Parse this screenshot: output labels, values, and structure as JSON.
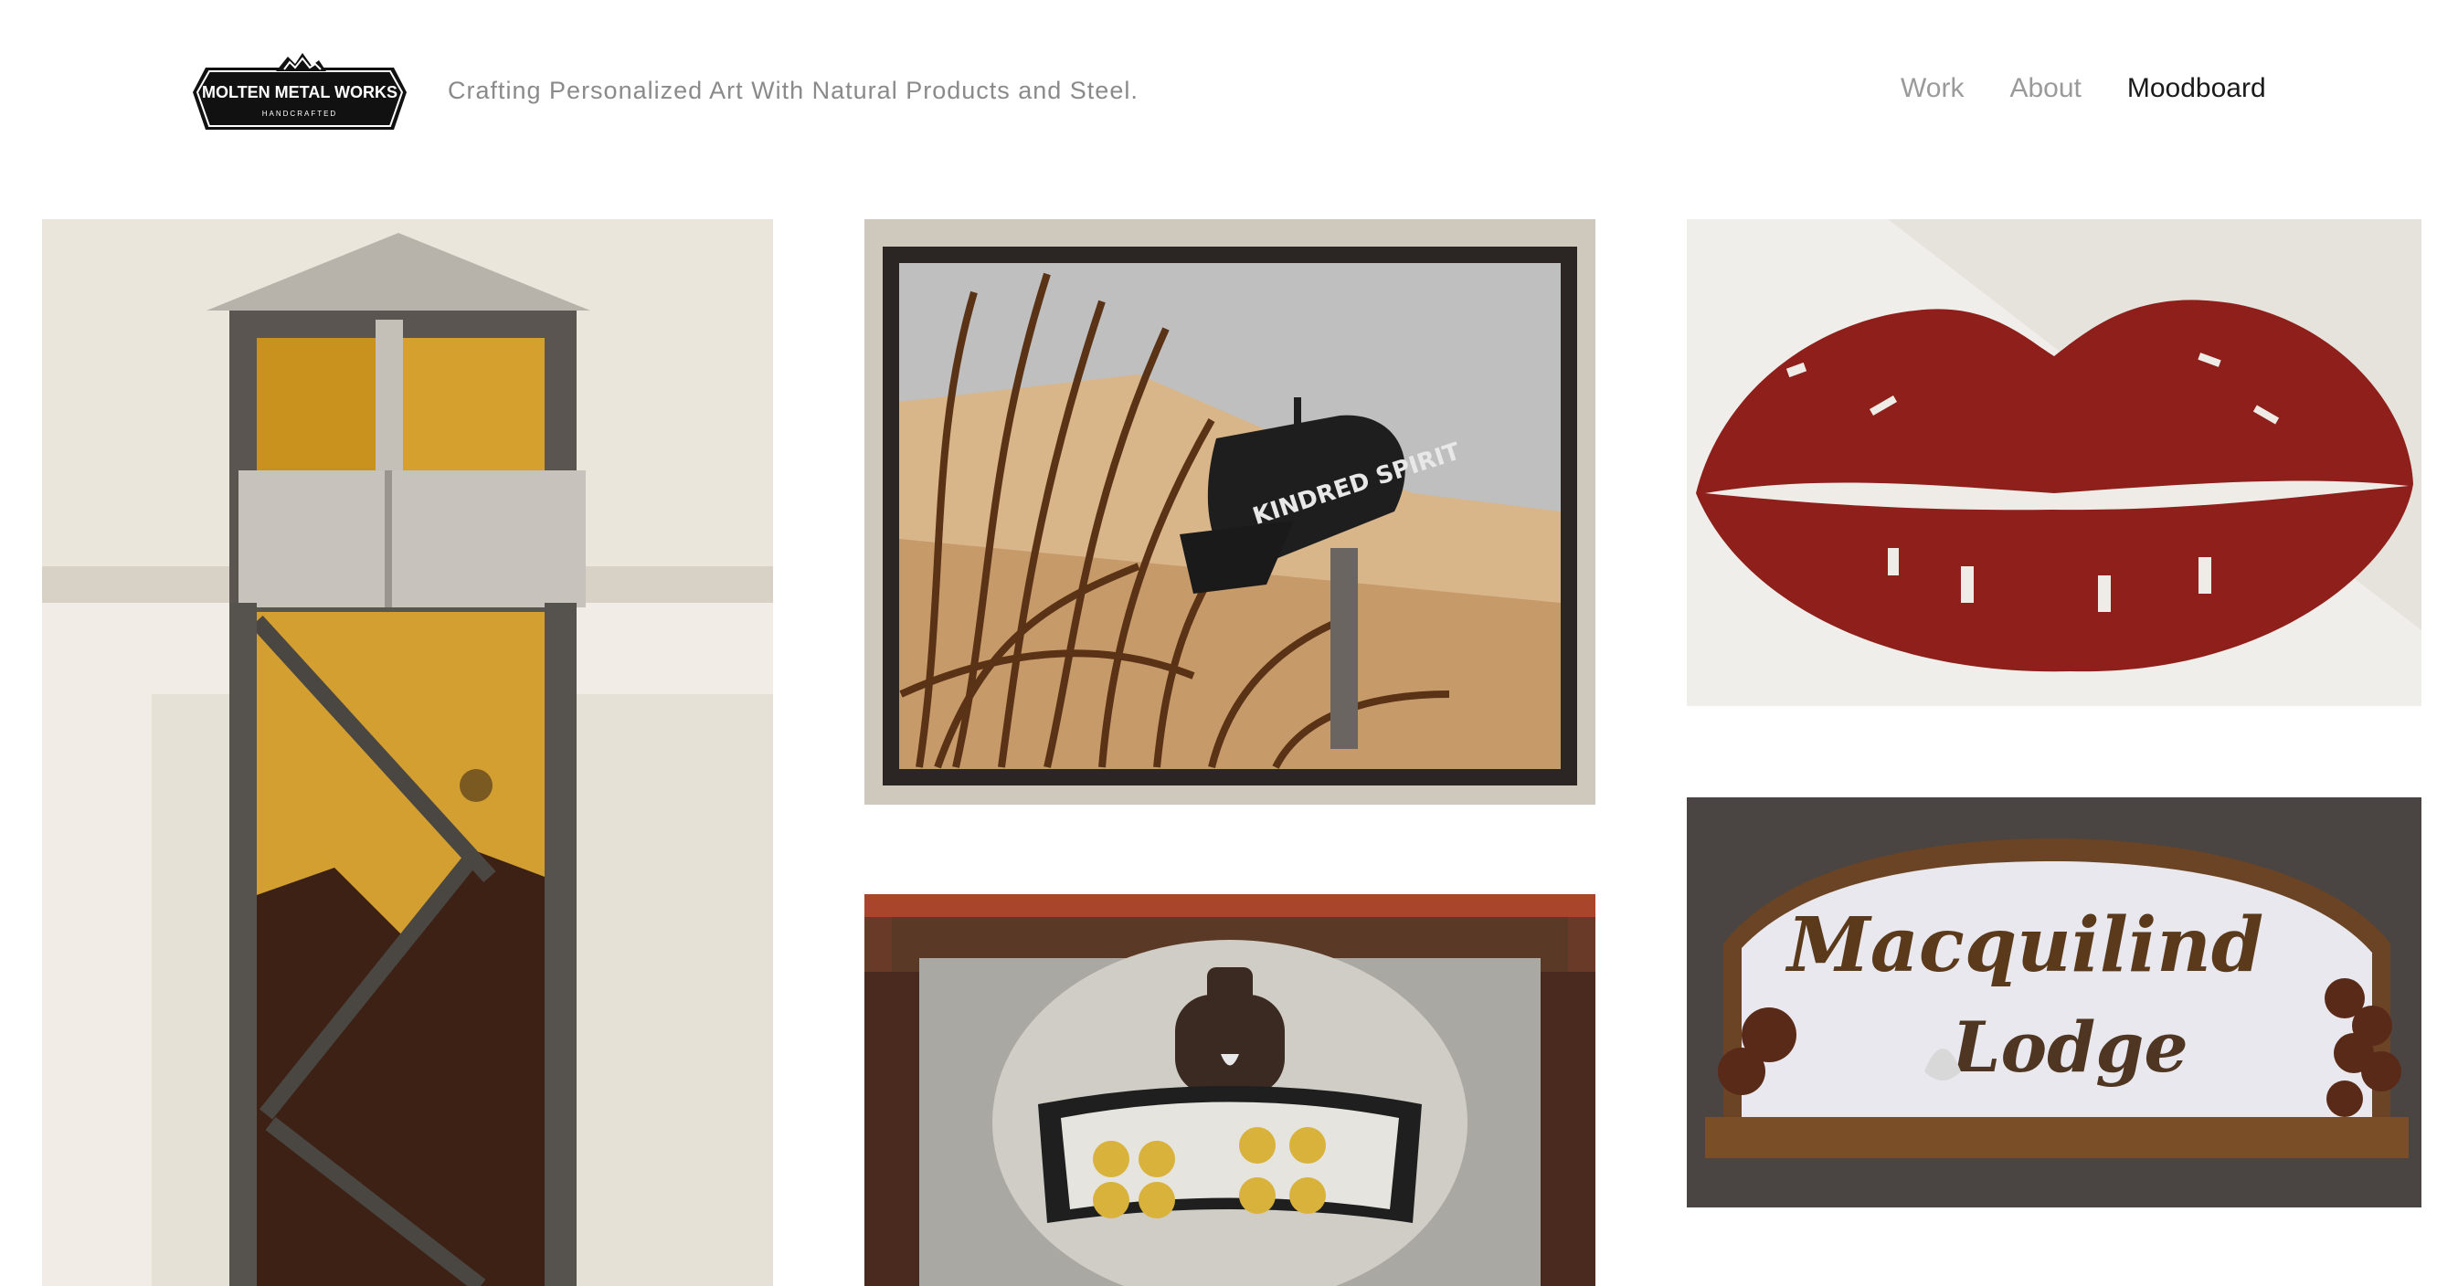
{
  "brand": {
    "logo_title": "MOLTEN METAL WORKS",
    "logo_subtitle": "HANDCRAFTED",
    "tagline": "Crafting Personalized Art With Natural Products and Steel."
  },
  "nav": {
    "items": [
      {
        "label": "Work",
        "active": false
      },
      {
        "label": "About",
        "active": false
      },
      {
        "label": "Moodboard",
        "active": true
      }
    ]
  },
  "gallery": {
    "mailbox_text": "KINDRED SPIRIT",
    "lodge_text_1": "Macquilind",
    "lodge_text_2": "Lodge"
  },
  "colors": {
    "text_muted": "#8a8a8a",
    "text_active": "#1a1a1a",
    "background": "#ffffff"
  }
}
